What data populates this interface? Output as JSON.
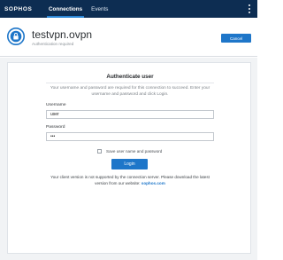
{
  "topbar": {
    "logo": "SOPHOS",
    "tabs": [
      {
        "label": "Connections",
        "active": true
      },
      {
        "label": "Events",
        "active": false
      }
    ],
    "menu_icon": "kebab-menu-icon"
  },
  "header": {
    "icon": "vpn-connection-icon",
    "title": "testvpn.ovpn",
    "subtitle": "Authentication required",
    "cancel_label": "Cancel"
  },
  "auth": {
    "title": "Authenticate user",
    "description": "Your username and password are required for this connection to succeed. Enter your username and password and click Login.",
    "username_label": "Username",
    "username_value": "user",
    "password_label": "Password",
    "password_value": "•••",
    "remember_label": "Save user name and password",
    "remember_checked": false,
    "login_label": "Login",
    "notice_text": "Your client version is not supported by the connection server. Please download the latest version from our website: ",
    "notice_link": "sophos.com"
  },
  "colors": {
    "topbar": "#0d2d52",
    "accent": "#1e76c9",
    "background": "#f1f3f5"
  }
}
